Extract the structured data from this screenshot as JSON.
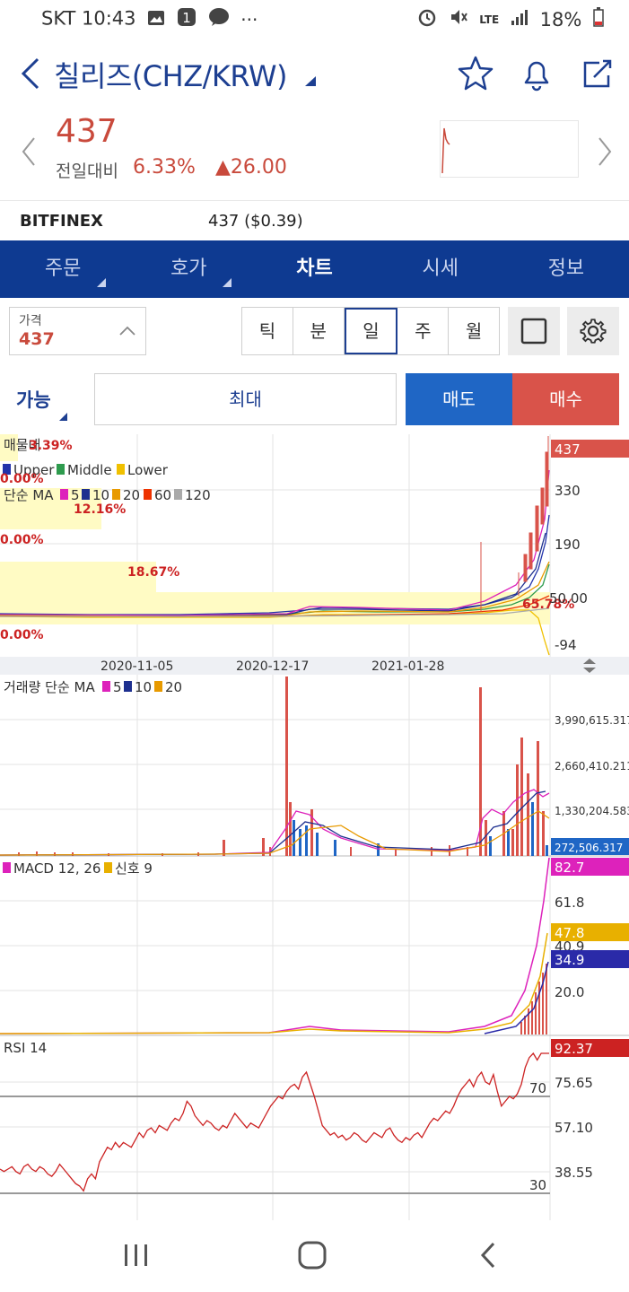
{
  "status": {
    "carrier_time": "SKT 10:43",
    "battery": "18%",
    "network": "LTE"
  },
  "header": {
    "title": "칠리즈(CHZ/KRW)"
  },
  "quote": {
    "price": "437",
    "change_label": "전일대비",
    "change_pct": "6.33%",
    "change_abs": "▲26.00"
  },
  "exchange": {
    "name": "BITFINEX",
    "price": "437 ($0.39)"
  },
  "tabs": [
    {
      "label": "주문",
      "has_menu": true
    },
    {
      "label": "호가",
      "has_menu": true
    },
    {
      "label": "차트",
      "active": true
    },
    {
      "label": "시세"
    },
    {
      "label": "정보"
    }
  ],
  "controls": {
    "price_select_label": "가격",
    "price_select_value": "437",
    "periods": [
      "틱",
      "분",
      "일",
      "주",
      "월"
    ],
    "active_period": "일",
    "available_label": "가능",
    "max_label": "최대",
    "sell_label": "매도",
    "buy_label": "매수"
  },
  "colors": {
    "brand_blue": "#0e3a91",
    "up_red": "#c94a3c",
    "sell_blue": "#1f66c5",
    "buy_red": "#d9534a"
  },
  "chart_data": [
    {
      "type": "line",
      "panel": "price",
      "legend_lines": [
        "매물대",
        "Upper Middle Lower",
        "단순 MA 5 10 20 60 120"
      ],
      "bollinger_labels": [
        "Upper",
        "Middle",
        "Lower"
      ],
      "ma_label": "단순 MA",
      "ma_periods": [
        "5",
        "10",
        "20",
        "60",
        "120"
      ],
      "volume_profile_label": "매물대",
      "volume_profile_pcts": [
        "3.39%",
        "0.00%",
        "12.16%",
        "0.00%",
        "18.67%",
        "65.78%",
        "0.00%"
      ],
      "y_ticks": [
        "437",
        "330",
        "190",
        "50.00",
        "-94"
      ],
      "current_value": "437",
      "x_ticks": [
        "2020-11-05",
        "2020-12-17",
        "2021-01-28"
      ]
    },
    {
      "type": "bar",
      "panel": "volume",
      "legend_label": "거래량 단순 MA",
      "ma_periods": [
        "5",
        "10",
        "20"
      ],
      "y_ticks": [
        "3,990,615.317",
        "2,660,410.211",
        "1,330,204.583"
      ],
      "current_value": "272,506.317"
    },
    {
      "type": "line",
      "panel": "macd",
      "legend_label": "MACD 12, 26",
      "signal_label": "신호 9",
      "y_ticks": [
        "61.8",
        "40.9",
        "20.0"
      ],
      "macd_value": "82.7",
      "signal_value": "47.8",
      "osc_value": "34.9"
    },
    {
      "type": "line",
      "panel": "rsi",
      "legend_label": "RSI 14",
      "y_ticks": [
        "75.65",
        "57.10",
        "38.55"
      ],
      "levels": [
        "70",
        "30"
      ],
      "current_value": "92.37",
      "values": [
        40,
        39,
        40,
        41,
        39,
        38,
        41,
        42,
        40,
        39,
        41,
        40,
        38,
        37,
        39,
        42,
        40,
        38,
        36,
        34,
        33,
        31,
        36,
        38,
        36,
        43,
        46,
        49,
        48,
        51,
        49,
        51,
        50,
        49,
        52,
        55,
        53,
        56,
        57,
        55,
        58,
        57,
        56,
        59,
        61,
        60,
        63,
        68,
        66,
        62,
        60,
        58,
        60,
        59,
        57,
        56,
        58,
        57,
        60,
        63,
        61,
        59,
        57,
        59,
        58,
        57,
        60,
        63,
        66,
        68,
        70,
        69,
        72,
        74,
        75,
        73,
        78,
        80,
        75,
        70,
        64,
        58,
        56,
        54,
        55,
        53,
        54,
        52,
        53,
        55,
        54,
        52,
        51,
        53,
        55,
        54,
        53,
        56,
        57,
        54,
        52,
        51,
        53,
        52,
        54,
        55,
        53,
        56,
        59,
        61,
        60,
        62,
        64,
        63,
        66,
        70,
        73,
        75,
        77,
        74,
        78,
        80,
        76,
        75,
        79,
        72,
        66,
        68,
        70,
        69,
        71,
        75,
        82,
        86,
        88,
        85,
        92,
        90,
        92
      ]
    }
  ]
}
